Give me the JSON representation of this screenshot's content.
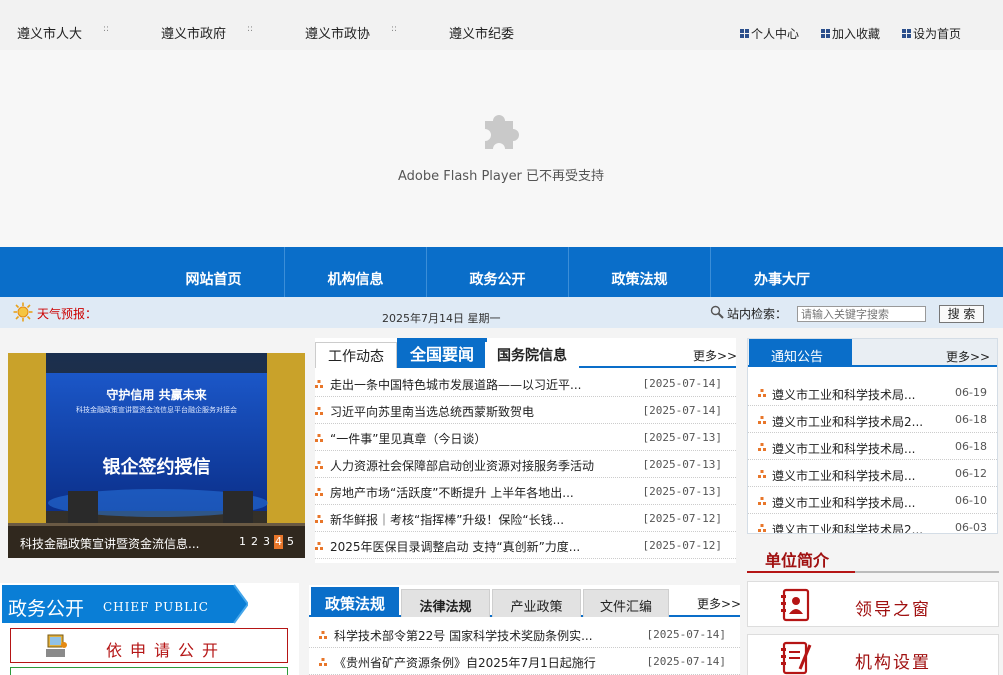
{
  "top_links": [
    "遵义市人大",
    "遵义市政府",
    "遵义市政协",
    "遵义市纪委"
  ],
  "top_sep": "::",
  "top_utils": [
    "个人中心",
    "加入收藏",
    "设为首页"
  ],
  "flash_message": "Adobe Flash Player 已不再受支持",
  "nav_items": [
    "网站首页",
    "机构信息",
    "政务公开",
    "政策法规",
    "办事大厅"
  ],
  "weather_label": "天气预报：",
  "date_text": "2025年7月14日  星期一",
  "search": {
    "label": "站内检索：",
    "placeholder": "请输入关键字搜索",
    "button": "搜 索"
  },
  "slideshow": {
    "caption": "科技金融政策宣讲暨资金流信息...",
    "banner_top": "守护信用 共赢未来",
    "banner_sub": "科技金融政策宣讲暨资金流信息平台融企服务对接会",
    "banner_main": "银企签约授信",
    "pages": [
      "1",
      "2",
      "3",
      "4",
      "5"
    ],
    "active_page": 3
  },
  "news": {
    "tabs": [
      "工作动态",
      "全国要闻",
      "国务院信息"
    ],
    "more": "更多>>",
    "items": [
      {
        "title": "走出一条中国特色城市发展道路——以习近平...",
        "date": "[2025-07-14]"
      },
      {
        "title": "习近平向苏里南当选总统西蒙斯致贺电",
        "date": "[2025-07-14]"
      },
      {
        "title": "“一件事”里见真章（今日谈）",
        "date": "[2025-07-13]"
      },
      {
        "title": "人力资源社会保障部启动创业资源对接服务季活动",
        "date": "[2025-07-13]"
      },
      {
        "title": "房地产市场“活跃度”不断提升 上半年各地出...",
        "date": "[2025-07-13]"
      },
      {
        "title": "新华鲜报｜考核“指挥棒”升级！保险“长钱...",
        "date": "[2025-07-12]"
      },
      {
        "title": "2025年医保目录调整启动 支持“真创新”力度...",
        "date": "[2025-07-12]"
      }
    ]
  },
  "notice": {
    "title": "通知公告",
    "more": "更多>>",
    "items": [
      {
        "title": "遵义市工业和科学技术局...",
        "date": "06-19"
      },
      {
        "title": "遵义市工业和科学技术局2...",
        "date": "06-18"
      },
      {
        "title": "遵义市工业和科学技术局...",
        "date": "06-18"
      },
      {
        "title": "遵义市工业和科学技术局...",
        "date": "06-12"
      },
      {
        "title": "遵义市工业和科学技术局...",
        "date": "06-10"
      },
      {
        "title": "遵义市工业和科学技术局2...",
        "date": "06-03"
      }
    ]
  },
  "unit": {
    "title": "单位简介",
    "buttons": [
      "领导之窗",
      "机构设置"
    ]
  },
  "gov_public": {
    "title": "政务公开",
    "subtitle": "CHIEF PUBLIC",
    "button": "依申请公开"
  },
  "policy": {
    "tabs": [
      "政策法规",
      "法律法规",
      "产业政策",
      "文件汇编"
    ],
    "more": "更多>>",
    "items": [
      {
        "title": "科学技术部令第22号 国家科学技术奖励条例实...",
        "date": "[2025-07-14]"
      },
      {
        "title": "《贵州省矿产资源条例》自2025年7月1日起施行",
        "date": "[2025-07-14]"
      }
    ]
  },
  "colors": {
    "nav_blue": "#0a6ec9",
    "accent_red": "#b51515",
    "orange": "#e8762a"
  }
}
